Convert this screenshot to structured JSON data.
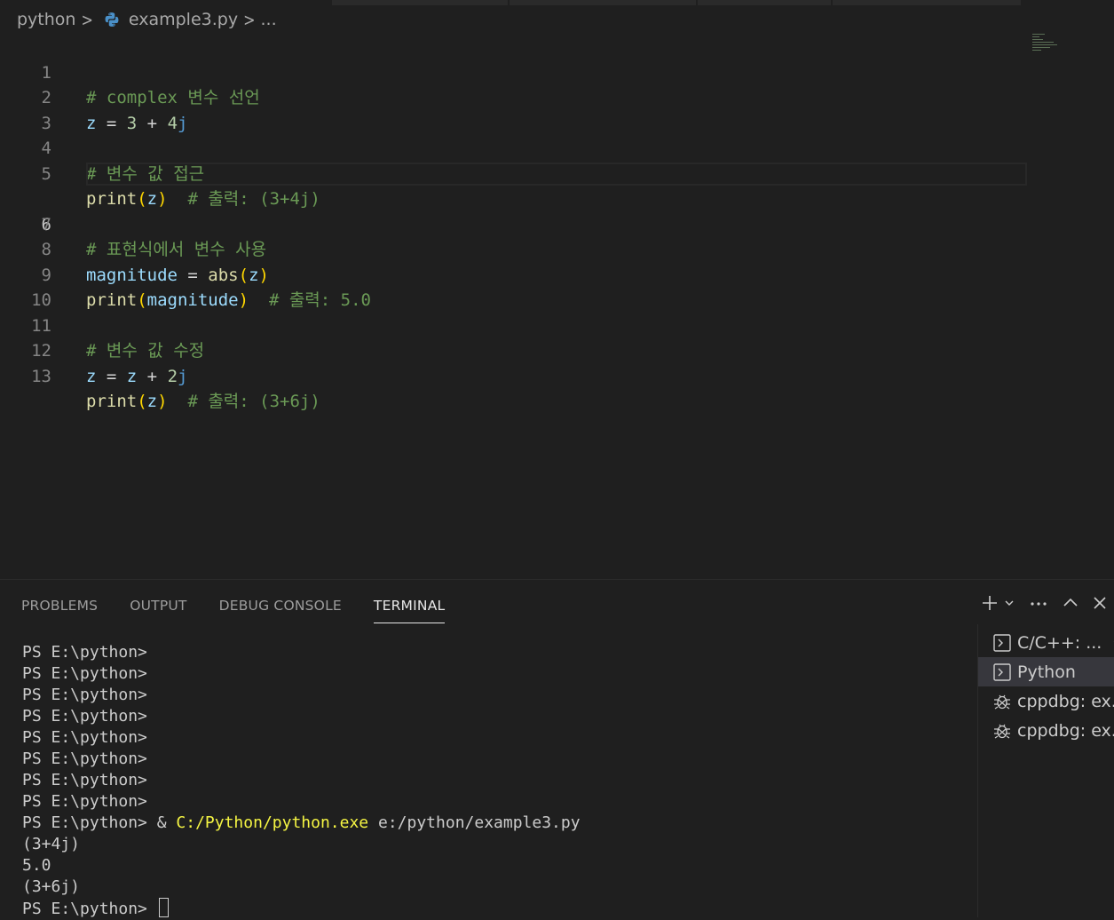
{
  "breadcrumb": {
    "folder": "python",
    "file": "example3.py",
    "ellipsis": "..."
  },
  "editor": {
    "active_line": 6,
    "lines": [
      {
        "n": "1"
      },
      {
        "n": "2"
      },
      {
        "n": "3"
      },
      {
        "n": "4"
      },
      {
        "n": "5"
      },
      {
        "n": "6"
      },
      {
        "n": "7"
      },
      {
        "n": "8"
      },
      {
        "n": "9"
      },
      {
        "n": "10"
      },
      {
        "n": "11"
      },
      {
        "n": "12"
      },
      {
        "n": "13"
      }
    ],
    "code": {
      "l1": "# complex 변수 선언",
      "l2_var": "z",
      "l2_eq": " = ",
      "l2_num1": "3",
      "l2_plus": " + ",
      "l2_num2": "4",
      "l2_j": "j",
      "l4": "# 변수 값 접근",
      "l5_fn": "print",
      "l5_p1": "(",
      "l5_var": "z",
      "l5_p2": ")",
      "l5_cm": "  # 출력: (3+4j)",
      "l7": "# 표현식에서 변수 사용",
      "l8_var": "magnitude",
      "l8_eq": " = ",
      "l8_fn": "abs",
      "l8_p1": "(",
      "l8_arg": "z",
      "l8_p2": ")",
      "l9_fn": "print",
      "l9_p1": "(",
      "l9_var": "magnitude",
      "l9_p2": ")",
      "l9_cm": "  # 출력: 5.0",
      "l11": "# 변수 값 수정",
      "l12_var": "z",
      "l12_eq": " = ",
      "l12_var2": "z",
      "l12_plus": " + ",
      "l12_num": "2",
      "l12_j": "j",
      "l13_fn": "print",
      "l13_p1": "(",
      "l13_var": "z",
      "l13_p2": ")",
      "l13_cm": "  # 출력: (3+6j)"
    }
  },
  "panel": {
    "tabs": [
      "PROBLEMS",
      "OUTPUT",
      "DEBUG CONSOLE",
      "TERMINAL"
    ],
    "active_tab": "TERMINAL",
    "terminal": {
      "prompt": "PS E:\\python>",
      "cmd_amp": " & ",
      "cmd_exe": "C:/Python/python.exe",
      "cmd_arg": " e:/python/example3.py",
      "out1": "(3+4j)",
      "out2": "5.0",
      "out3": "(3+6j)"
    },
    "terminals": [
      {
        "label": "C/C++: ...",
        "icon": "terminal-icon"
      },
      {
        "label": "Python",
        "icon": "terminal-icon"
      },
      {
        "label": "cppdbg: ex...",
        "icon": "debug-icon"
      },
      {
        "label": "cppdbg: ex...",
        "icon": "debug-icon"
      }
    ]
  }
}
